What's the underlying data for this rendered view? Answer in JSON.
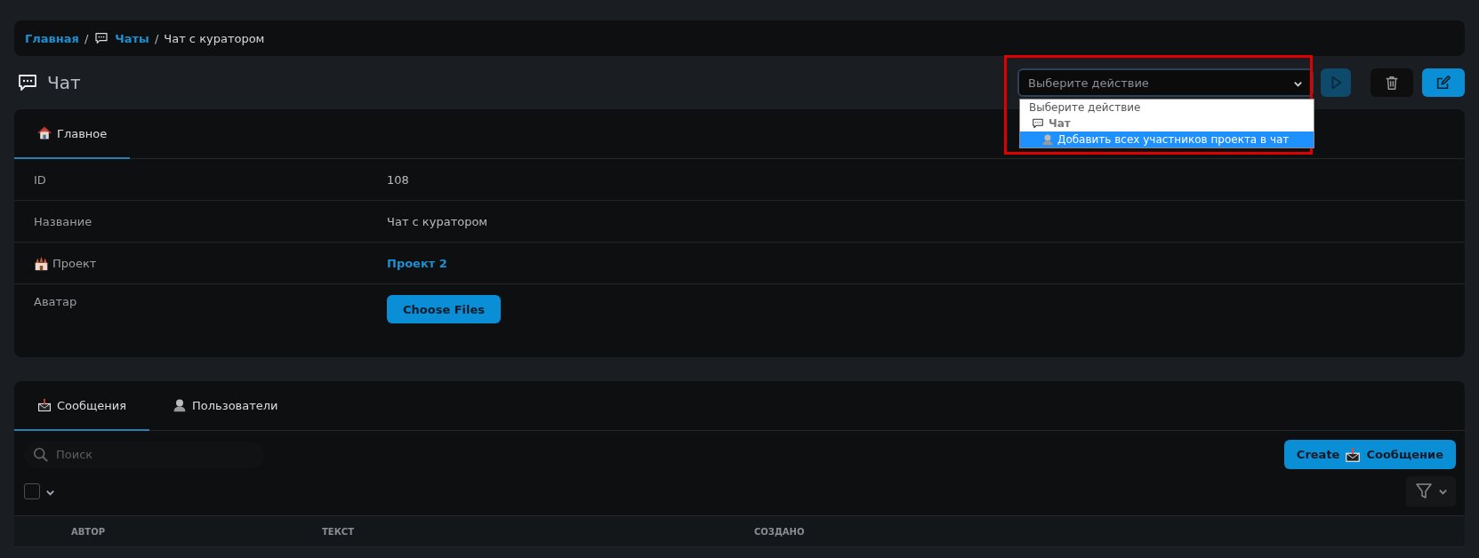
{
  "breadcrumb": [
    {
      "label": "Главная",
      "kind": "link"
    },
    {
      "separator": "/",
      "label": "Чаты",
      "kind": "chat-link"
    },
    {
      "separator": "/",
      "label": "Чат с куратором",
      "kind": "current"
    }
  ],
  "page_title": "Чат",
  "action_select": {
    "placeholder": "Выберите действие",
    "expanded": true,
    "options": [
      {
        "kind": "placeholder",
        "label": "Выберите действие"
      },
      {
        "kind": "group",
        "label": "Чат",
        "children": [
          {
            "label": "Добавить всех участников проекта в чат",
            "selected": true
          }
        ]
      }
    ]
  },
  "detail_tabs": [
    {
      "label": "Главное",
      "selected": true
    }
  ],
  "fields": [
    {
      "label": "ID",
      "kind": "text",
      "value": "108"
    },
    {
      "label": "Название",
      "kind": "text",
      "value": "Чат с куратором"
    },
    {
      "label": "Проект",
      "kind": "link",
      "value": "Проект 2",
      "icon": true
    },
    {
      "label": "Аватар",
      "kind": "file",
      "value": "Choose Files"
    }
  ],
  "relation_tabs": [
    {
      "label": "Сообщения",
      "selected": true
    },
    {
      "label": "Пользователи",
      "selected": false
    }
  ],
  "search": {
    "placeholder": "Поиск"
  },
  "create_button": {
    "prefix": "Create",
    "label": "Сообщение"
  },
  "select_all": {
    "checked": false
  },
  "table": {
    "columns": [
      "АВТОР",
      "ТЕКСТ",
      "СОЗДАНО"
    ]
  }
}
